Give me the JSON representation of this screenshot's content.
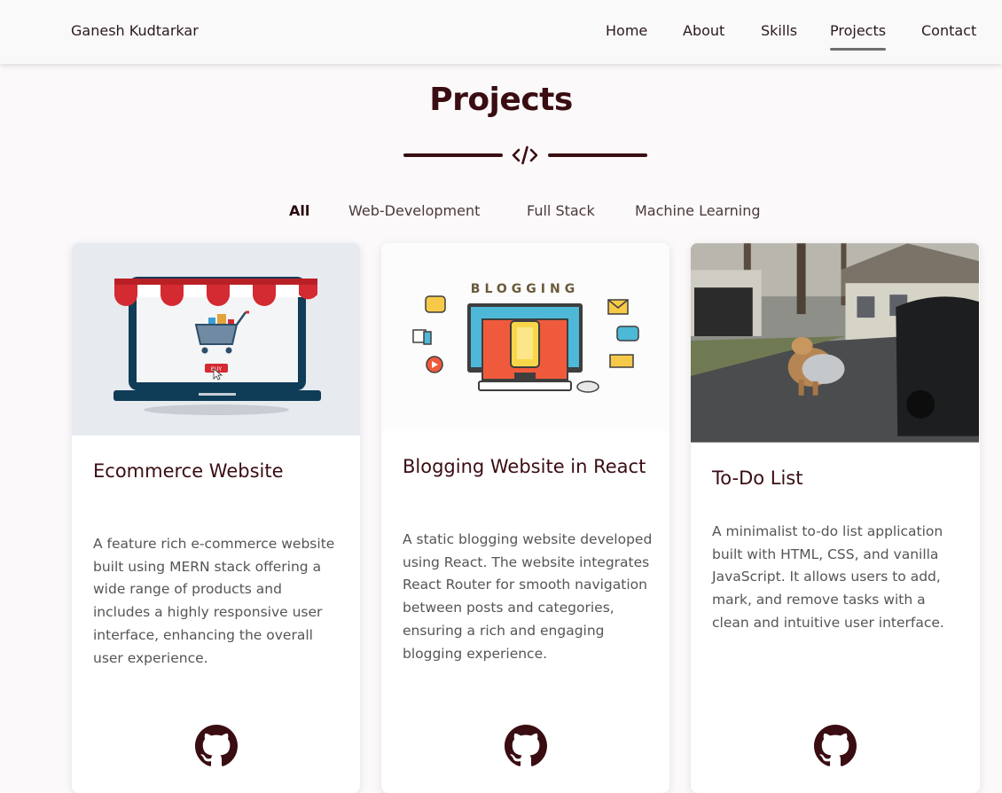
{
  "nav": {
    "brand": "Ganesh Kudtarkar",
    "links": [
      {
        "label": "Home",
        "active": false
      },
      {
        "label": "About",
        "active": false
      },
      {
        "label": "Skills",
        "active": false
      },
      {
        "label": "Projects",
        "active": true
      },
      {
        "label": "Contact",
        "active": false
      }
    ]
  },
  "section": {
    "title": "Projects",
    "divider_icon": "code-icon"
  },
  "filters": [
    {
      "label": "All",
      "active": true
    },
    {
      "label": "Web-Development",
      "active": false
    },
    {
      "label": "Full Stack",
      "active": false
    },
    {
      "label": "Machine Learning",
      "active": false
    }
  ],
  "projects": [
    {
      "title": "Ecommerce Website",
      "description": "A feature rich e-commerce website built using MERN stack offering a wide range of products and includes a highly responsive user interface, enhancing the overall user experience.",
      "image": "ecommerce-illustration",
      "link_icon": "github-icon",
      "buy_label": "BUY"
    },
    {
      "title": "Blogging Website in React",
      "description": "A static blogging website developed using React. The website integrates React Router for smooth navigation between posts and categories, ensuring a rich and engaging blogging experience.",
      "image": "blogging-illustration",
      "banner": "BLOGGING",
      "link_icon": "github-icon"
    },
    {
      "title": "To-Do List",
      "description": "A minimalist to-do list application built with HTML, CSS, and vanilla JavaScript. It allows users to add, mark, and remove tasks with a clean and intuitive user interface.",
      "image": "dog-carrying-trash-bag-photo",
      "link_icon": "github-icon"
    }
  ],
  "colors": {
    "accent": "#3a0d12",
    "background": "#fbf9f9",
    "card": "#ffffff",
    "text_muted": "#555555"
  }
}
